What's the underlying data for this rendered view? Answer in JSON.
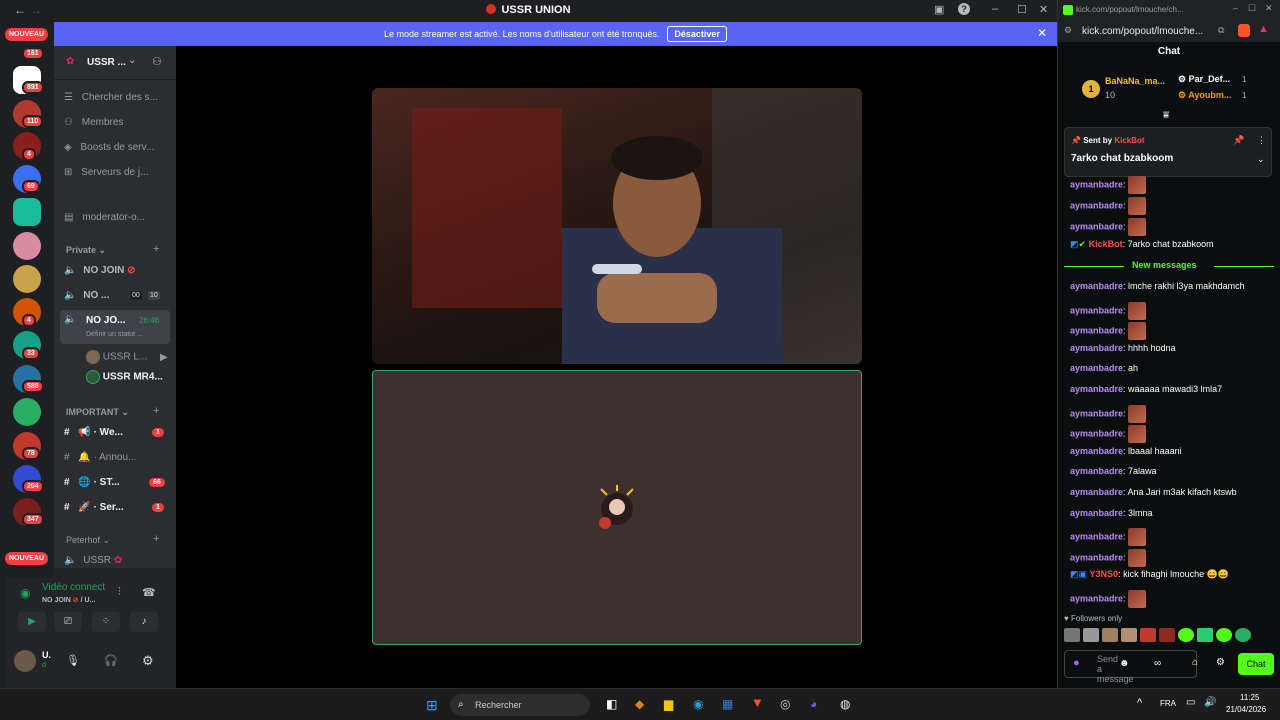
{
  "discord": {
    "window_title": "USSR UNION",
    "banner": {
      "text": "Le mode streamer est activé. Les noms d'utilisateur ont été tronqués.",
      "button": "Désactiver"
    },
    "guild_badges": {
      "nouveau_top": "NOUVEAU",
      "b1": "161",
      "b2": "891",
      "b3": "110",
      "b4": "4",
      "b5": "69",
      "b6": "4",
      "b7": "33",
      "b8": "588",
      "b9": "78",
      "b10": "204",
      "b11": "347",
      "nouveau_bottom": "NOUVEAU"
    },
    "server_name": "USSR ...",
    "menu": {
      "search": "Chercher des s...",
      "members": "Membres",
      "boosts": "Boosts de serv...",
      "servers": "Serveurs de j...",
      "moderator": "moderator-o..."
    },
    "private": {
      "label": "Private",
      "ch1": "NO JOIN",
      "ch2": "NO ...",
      "ch2_a": "00",
      "ch2_b": "10",
      "ch3": "NO JO...",
      "ch3_time": "26:46",
      "ch3_status": "Définir un statut ...",
      "user1": "USSR L...",
      "user2": "USSR MR4..."
    },
    "important": {
      "label": "IMPORTANT",
      "ch1": "· We...",
      "ch1_badge": "1",
      "ch2": "· Annou...",
      "ch3": "· ST...",
      "ch3_badge": "66",
      "ch4": "· Ser...",
      "ch4_badge": "1"
    },
    "peterhof": {
      "label": "Peterhof",
      "ch1": "USSR"
    },
    "voice": {
      "status": "Vidéo connect",
      "channel": "NO JOIN",
      "channel_suffix": "/ U..."
    },
    "user": {
      "name": "U.",
      "sub": "d"
    }
  },
  "kick": {
    "url_title": "kick.com/popout/lmouche/ch...",
    "url": "kick.com/popout/lmouche...",
    "header": "Chat",
    "leaders": {
      "first_name": "BaNaNa_ma...",
      "first_count": "10",
      "rank": "1",
      "second": "Par_Def...",
      "second_n": "1",
      "third": "Ayoubm...",
      "third_n": "1"
    },
    "pinned": {
      "sent_by": "Sent by",
      "bot": "KickBot",
      "text": "7arko chat bzabkoom"
    },
    "messages": [
      {
        "user": "aymanbadre",
        "text": "",
        "emote": true
      },
      {
        "user": "aymanbadre",
        "text": "",
        "emote": true
      },
      {
        "user": "aymanbadre",
        "text": "",
        "emote": true
      },
      {
        "user": "KickBot",
        "text": "7arko chat bzabkoom",
        "bot": true
      }
    ],
    "new_messages": "New messages",
    "messages2": [
      {
        "user": "aymanbadre",
        "text": "lmche rakhi l3ya makhdamch"
      },
      {
        "user": "aymanbadre",
        "text": "",
        "emote": true
      },
      {
        "user": "aymanbadre",
        "text": "",
        "emote": true
      },
      {
        "user": "aymanbadre",
        "text": "hhhh hodna"
      },
      {
        "user": "aymanbadre",
        "text": "ah"
      },
      {
        "user": "aymanbadre",
        "text": "waaaaa mawadi3 lmla7"
      },
      {
        "user": "aymanbadre",
        "text": "",
        "emote": true
      },
      {
        "user": "aymanbadre",
        "text": "",
        "emote": true
      },
      {
        "user": "aymanbadre",
        "text": "lbaaal haaani"
      },
      {
        "user": "aymanbadre",
        "text": "7alawa"
      },
      {
        "user": "aymanbadre",
        "text": "Ana Jari m3ak kifach ktswb"
      },
      {
        "user": "aymanbadre",
        "text": "3lmna"
      },
      {
        "user": "aymanbadre",
        "text": "",
        "emote": true
      },
      {
        "user": "aymanbadre",
        "text": "",
        "emote": true
      },
      {
        "user": "Y3NS0",
        "text": "kick fihaghi lmouche 😄😄",
        "red": true
      },
      {
        "user": "aymanbadre",
        "text": "",
        "emote": true
      }
    ],
    "followers_only": "Followers only",
    "send_placeholder": "Send a message",
    "chat_button": "Chat"
  },
  "taskbar": {
    "search": "Rechercher",
    "lang": "FRA",
    "time": "11:25",
    "date": "21/04/2026"
  }
}
